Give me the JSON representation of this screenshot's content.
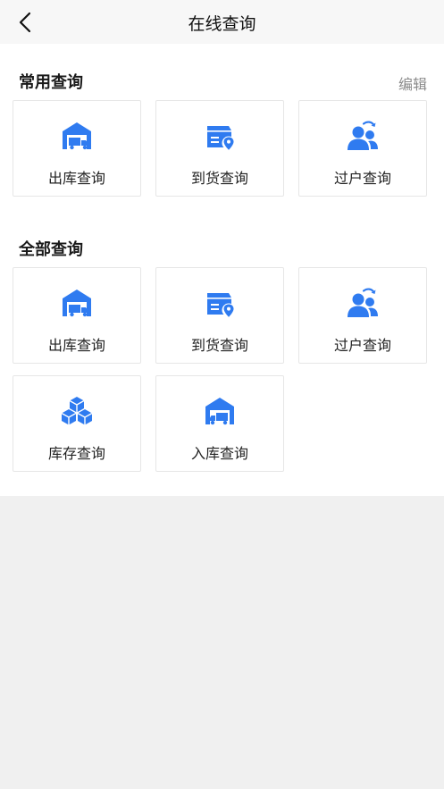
{
  "header": {
    "title": "在线查询"
  },
  "colors": {
    "accent": "#2f7bf0"
  },
  "common": {
    "title": "常用查询",
    "edit_label": "编辑",
    "items": [
      {
        "label": "出库查询",
        "icon": "warehouse-truck-icon"
      },
      {
        "label": "到货查询",
        "icon": "package-location-icon"
      },
      {
        "label": "过户查询",
        "icon": "users-transfer-icon"
      }
    ]
  },
  "all": {
    "title": "全部查询",
    "items": [
      {
        "label": "出库查询",
        "icon": "warehouse-truck-icon"
      },
      {
        "label": "到货查询",
        "icon": "package-location-icon"
      },
      {
        "label": "过户查询",
        "icon": "users-transfer-icon"
      },
      {
        "label": "库存查询",
        "icon": "boxes-stack-icon"
      },
      {
        "label": "入库查询",
        "icon": "warehouse-inbound-icon"
      }
    ]
  }
}
